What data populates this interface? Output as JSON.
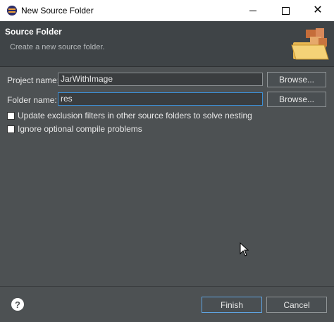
{
  "window": {
    "title": "New Source Folder",
    "minimize_icon": "minimize-icon",
    "maximize_icon": "maximize-icon",
    "close_icon": "close-icon"
  },
  "header": {
    "title": "Source Folder",
    "description": "Create a new source folder.",
    "graphic_icon": "folder-stack-icon"
  },
  "form": {
    "project_label": "Project name:",
    "project_value": "JarWithImage",
    "project_browse": "Browse...",
    "folder_label": "Folder name:",
    "folder_value": "res",
    "folder_browse": "Browse...",
    "update_exclusion_label": "Update exclusion filters in other source folders to solve nesting",
    "update_exclusion_checked": false,
    "ignore_optional_label": "Ignore optional compile problems",
    "ignore_optional_checked": false
  },
  "footer": {
    "help_icon": "help-icon",
    "help_glyph": "?",
    "finish_label": "Finish",
    "cancel_label": "Cancel"
  },
  "colors": {
    "background": "#4d5153",
    "header_bg": "#3f4447",
    "focus_border": "#3c8fd6"
  }
}
